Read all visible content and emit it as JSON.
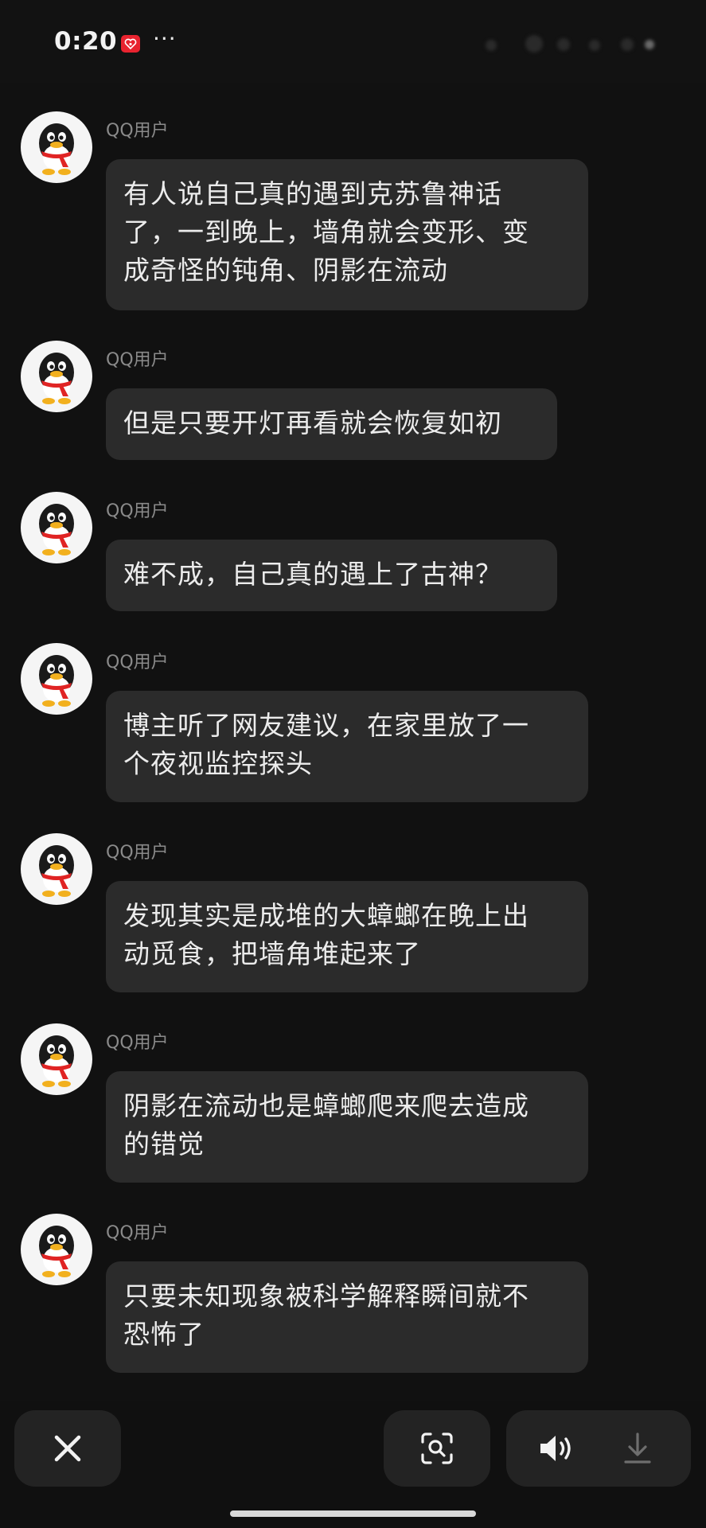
{
  "status_bar": {
    "time": "0:20",
    "app_badge_icon": "red-heart-app-icon",
    "more_indicator": "···"
  },
  "messages": [
    {
      "sender": "QQ用户",
      "text": "有人说自己真的遇到克苏鲁神话\n了，一到晚上，墙角就会变形、变\n成奇怪的钝角、阴影在流动"
    },
    {
      "sender": "QQ用户",
      "text": "但是只要开灯再看就会恢复如初"
    },
    {
      "sender": "QQ用户",
      "text": "难不成，自己真的遇上了古神？"
    },
    {
      "sender": "QQ用户",
      "text": "博主听了网友建议，在家里放了一\n个夜视监控探头"
    },
    {
      "sender": "QQ用户",
      "text": "发现其实是成堆的大蟑螂在晚上出\n动觅食，把墙角堆起来了"
    },
    {
      "sender": "QQ用户",
      "text": "阴影在流动也是蟑螂爬来爬去造成\n的错觉"
    },
    {
      "sender": "QQ用户",
      "text": "只要未知现象被科学解释瞬间就不\n恐怖了"
    }
  ],
  "bottom_bar": {
    "close_icon": "close-icon",
    "scan_icon": "image-search-icon",
    "volume_icon": "speaker-icon",
    "download_icon": "download-icon"
  },
  "colors": {
    "background": "#111111",
    "bubble": "#2b2b2b",
    "text": "#ececec",
    "sender": "#8a8a8a",
    "badge": "#e8232f"
  }
}
